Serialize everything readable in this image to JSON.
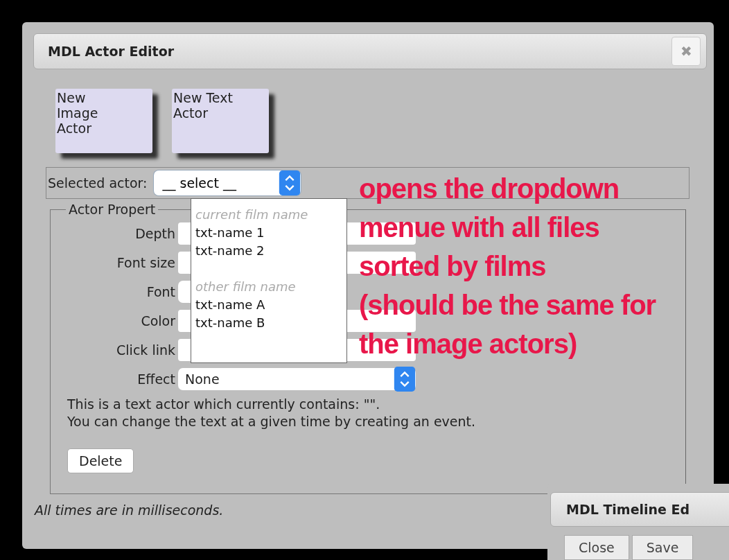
{
  "window": {
    "title": "MDL Actor Editor",
    "close": "✖"
  },
  "new_buttons": [
    {
      "label": "New Image Actor"
    },
    {
      "label": "New Text Actor"
    }
  ],
  "selected_actor": {
    "label": "Selected actor:",
    "value": "__ select __",
    "expanded": true,
    "dropdown": [
      {
        "group": "current film name",
        "options": [
          "txt-name 1",
          "txt-name 2"
        ]
      },
      {
        "group": "other film name",
        "options": [
          "txt-name A",
          "txt-name B"
        ]
      }
    ]
  },
  "properties": {
    "legend": "Actor Propert",
    "fields": [
      {
        "label": "Depth",
        "kind": "text"
      },
      {
        "label": "Font size",
        "kind": "text"
      },
      {
        "label": "Font",
        "kind": "select"
      },
      {
        "label": "Color",
        "kind": "text"
      },
      {
        "label": "Click link",
        "kind": "text"
      },
      {
        "label": "Effect",
        "kind": "select",
        "value": "None"
      }
    ],
    "description": [
      "This is a text actor which currently contains: \"\".",
      "You can change the text at a given time by creating an event."
    ],
    "delete": "Delete"
  },
  "footnote": "All times are in milliseconds.",
  "annotation": [
    "opens the dropdown",
    "menue with all files",
    "sorted by films",
    "(should be the same for",
    "the image actors)"
  ],
  "timeline_window": {
    "title": "MDL Timeline Ed",
    "buttons": [
      "Close",
      "Save"
    ]
  }
}
